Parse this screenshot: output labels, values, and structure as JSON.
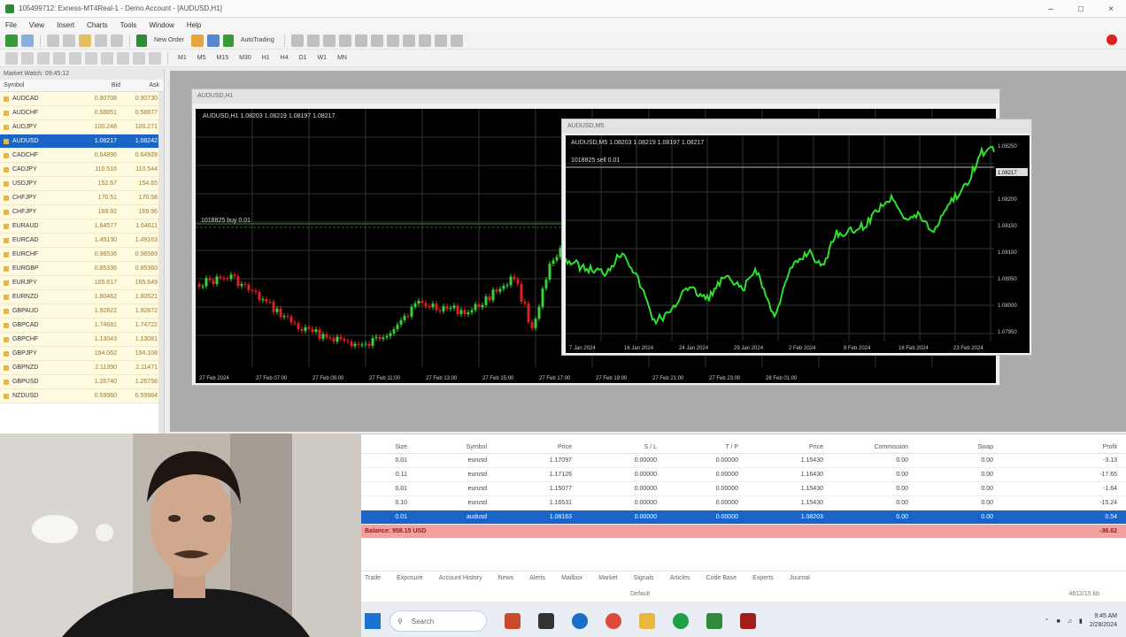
{
  "window": {
    "title": "105499712: Exness-MT4Real-1 - Demo Account - [AUDUSD,H1]"
  },
  "menu": [
    "File",
    "View",
    "Insert",
    "Charts",
    "Tools",
    "Window",
    "Help"
  ],
  "toolbar": {
    "new_order": "New Order",
    "auto_trading": "AutoTrading"
  },
  "timeframes": [
    "M1",
    "M5",
    "M15",
    "M30",
    "H1",
    "H4",
    "D1",
    "W1",
    "MN"
  ],
  "market_watch": {
    "title": "Market Watch: 09:45:12",
    "headers": [
      "Symbol",
      "Bid",
      "Ask"
    ],
    "rows": [
      {
        "symbol": "AUDCAD",
        "bid": "0.90708",
        "ask": "0.90730"
      },
      {
        "symbol": "AUDCHF",
        "bid": "0.58851",
        "ask": "0.58877"
      },
      {
        "symbol": "AUDJPY",
        "bid": "100.248",
        "ask": "100.271"
      },
      {
        "symbol": "AUDUSD",
        "bid": "1.08217",
        "ask": "1.08242"
      },
      {
        "symbol": "CADCHF",
        "bid": "0.64896",
        "ask": "0.64928"
      },
      {
        "symbol": "CADJPY",
        "bid": "110.516",
        "ask": "110.544"
      },
      {
        "symbol": "USDJPY",
        "bid": "152.67",
        "ask": "154.65"
      },
      {
        "symbol": "CHFJPY",
        "bid": "170.51",
        "ask": "170.58"
      },
      {
        "symbol": "CHFJPY",
        "bid": "169.92",
        "ask": "169.96"
      },
      {
        "symbol": "EURAUD",
        "bid": "1.64577",
        "ask": "1.64611"
      },
      {
        "symbol": "EURCAD",
        "bid": "1.49130",
        "ask": "1.49163"
      },
      {
        "symbol": "EURCHF",
        "bid": "0.96536",
        "ask": "0.96569"
      },
      {
        "symbol": "EURGBP",
        "bid": "0.85336",
        "ask": "0.85360"
      },
      {
        "symbol": "EURJPY",
        "bid": "165.617",
        "ask": "165.649"
      },
      {
        "symbol": "EURNZD",
        "bid": "1.80462",
        "ask": "1.80521"
      },
      {
        "symbol": "GBPAUD",
        "bid": "1.92822",
        "ask": "1.92872"
      },
      {
        "symbol": "GBPCAD",
        "bid": "1.74681",
        "ask": "1.74722"
      },
      {
        "symbol": "GBPCHF",
        "bid": "1.13043",
        "ask": "1.13081"
      },
      {
        "symbol": "GBPJPY",
        "bid": "194.062",
        "ask": "194.108"
      },
      {
        "symbol": "GBPNZD",
        "bid": "2.11390",
        "ask": "2.11471"
      },
      {
        "symbol": "GBPUSD",
        "bid": "1.26740",
        "ask": "1.26758"
      },
      {
        "symbol": "NZDUSD",
        "bid": "0.59960",
        "ask": "0.59984"
      }
    ],
    "selected_index": 3
  },
  "chart_main": {
    "title": "AUDUSD,H1",
    "info": "AUDUSD,H1  1.08203 1.08219 1.08197 1.08217",
    "label": "1018825 buy 0.01",
    "time_labels": [
      "27 Feb 2024",
      "27 Feb 07:00",
      "27 Feb 09:00",
      "27 Feb 11:00",
      "27 Feb 13:00",
      "27 Feb 15:00",
      "27 Feb 17:00",
      "27 Feb 19:00",
      "27 Feb 21:00",
      "27 Feb 23:00",
      "28 Feb 01:00"
    ]
  },
  "chart_detail": {
    "title": "AUDUSD,M5",
    "info": "AUDUSD,M5  1.08203 1.08219 1.08197 1.08217",
    "label": "1018825 sell 0.01",
    "price_labels": [
      "1.08250",
      "1.08217",
      "1.08200",
      "1.08150",
      "1.08100",
      "1.08050",
      "1.08000",
      "1.07950"
    ],
    "time_labels": [
      "7 Jan 2024",
      "16 Jan 2024",
      "24 Jan 2024",
      "29 Jan 2024",
      "2 Feb 2024",
      "9 Feb 2024",
      "16 Feb 2024",
      "23 Feb 2024"
    ]
  },
  "terminal": {
    "headers": [
      "Size",
      "Symbol",
      "Price",
      "S / L",
      "T / P",
      "Price",
      "Commission",
      "Swap",
      "Profit"
    ],
    "rows": [
      {
        "size": "0.01",
        "symbol": "eurusd",
        "price": "1.17097",
        "sl": "0.00000",
        "tp": "0.00000",
        "cur": "1.15430",
        "comm": "0.00",
        "swap": "0.00",
        "profit": "-3.13"
      },
      {
        "size": "0.11",
        "symbol": "eurusd",
        "price": "1.17126",
        "sl": "0.00000",
        "tp": "0.00000",
        "cur": "1.16430",
        "comm": "0.00",
        "swap": "0.00",
        "profit": "-17.65"
      },
      {
        "size": "0.01",
        "symbol": "eurusd",
        "price": "1.15077",
        "sl": "0.00000",
        "tp": "0.00000",
        "cur": "1.15430",
        "comm": "0.00",
        "swap": "0.00",
        "profit": "-1.64"
      },
      {
        "size": "0.10",
        "symbol": "eurusd",
        "price": "1.16531",
        "sl": "0.00000",
        "tp": "0.00000",
        "cur": "1.15430",
        "comm": "0.00",
        "swap": "0.00",
        "profit": "-15.24"
      },
      {
        "size": "0.01",
        "symbol": "audusd",
        "price": "1.08163",
        "sl": "0.00000",
        "tp": "0.00000",
        "cur": "1.08203",
        "comm": "0.00",
        "swap": "0.00",
        "profit": "0.54"
      }
    ],
    "balance": {
      "label": "Balance: 958.15 USD",
      "profit": "-36.62"
    },
    "tabs": [
      "Trade",
      "Exposure",
      "Account History",
      "News",
      "Alerts",
      "Mailbox",
      "Market",
      "Signals",
      "Articles",
      "Code Base",
      "Experts",
      "Journal"
    ],
    "status": "Default",
    "status_right": "4812/15 kb"
  },
  "taskbar": {
    "search": "Search",
    "time": "9:45 AM",
    "date": "2/28/2024"
  }
}
